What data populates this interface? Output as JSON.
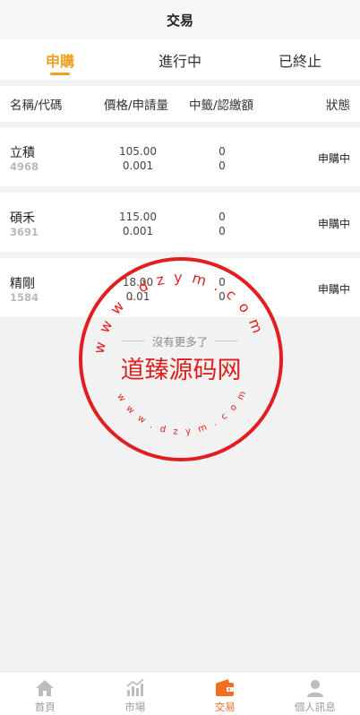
{
  "header": {
    "title": "交易"
  },
  "tabs": [
    {
      "label": "申購",
      "active": true
    },
    {
      "label": "進行中",
      "active": false
    },
    {
      "label": "已終止",
      "active": false
    }
  ],
  "table": {
    "columns": [
      "名稱/代碼",
      "價格/申請量",
      "中籤/認繳額",
      "狀態"
    ],
    "rows": [
      {
        "name": "立積",
        "code": "4968",
        "price": "105.00",
        "quantity": "0.001",
        "drawn": "0",
        "subscribed": "0",
        "status": "申購中"
      },
      {
        "name": "碩禾",
        "code": "3691",
        "price": "115.00",
        "quantity": "0.001",
        "drawn": "0",
        "subscribed": "0",
        "status": "申購中"
      },
      {
        "name": "精剛",
        "code": "1584",
        "price": "18.00",
        "quantity": "0.01",
        "drawn": "0",
        "subscribed": "0",
        "status": "申購中"
      }
    ]
  },
  "list_end_text": "沒有更多了",
  "watermark": {
    "name": "道臻源码网",
    "url": "www.dzym.com",
    "color": "#e02020"
  },
  "colors": {
    "accent": "#f0a020",
    "nav_active": "#f07020"
  },
  "bottom_nav": [
    {
      "label": "首頁",
      "icon": "home-icon",
      "active": false
    },
    {
      "label": "市場",
      "icon": "chart-icon",
      "active": false
    },
    {
      "label": "交易",
      "icon": "wallet-icon",
      "active": true
    },
    {
      "label": "個人訊息",
      "icon": "user-icon",
      "active": false
    }
  ]
}
